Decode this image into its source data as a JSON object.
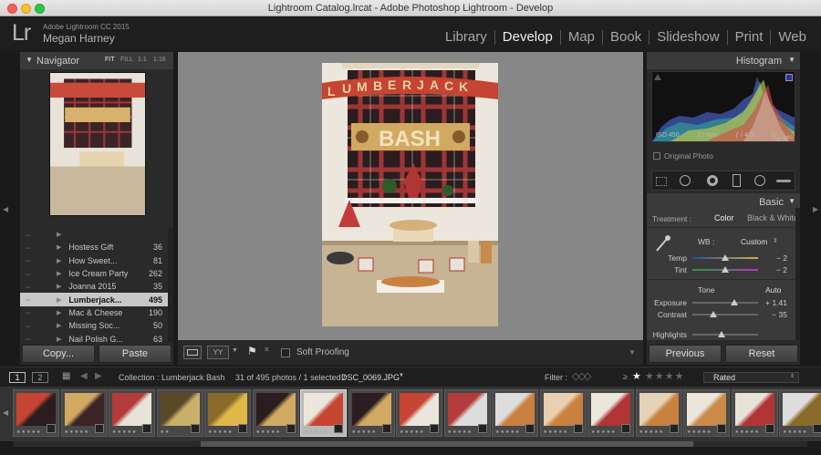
{
  "window": {
    "title": "Lightroom Catalog.lrcat - Adobe Photoshop Lightroom - Develop"
  },
  "identity": {
    "logo": "Lr",
    "product": "Adobe Lightroom CC 2015",
    "user": "Megan Harney"
  },
  "modules": [
    {
      "label": "Library"
    },
    {
      "label": "Develop",
      "active": true
    },
    {
      "label": "Map"
    },
    {
      "label": "Book"
    },
    {
      "label": "Slideshow"
    },
    {
      "label": "Print"
    },
    {
      "label": "Web"
    }
  ],
  "navigator": {
    "title": "Navigator",
    "zoom": [
      "FIT",
      "FILL",
      "1:1",
      "1:16"
    ]
  },
  "collections": [
    {
      "name": "",
      "count": ""
    },
    {
      "name": "Hostess Gift",
      "count": "36"
    },
    {
      "name": "How Sweet...",
      "count": "81"
    },
    {
      "name": "Ice Cream Party",
      "count": "262"
    },
    {
      "name": "Joanna 2015",
      "count": "35"
    },
    {
      "name": "Lumberjack...",
      "count": "495",
      "selected": true
    },
    {
      "name": "Mac & Cheese",
      "count": "190"
    },
    {
      "name": "Missing Soc...",
      "count": "50"
    },
    {
      "name": "Nail Polish G...",
      "count": "63"
    },
    {
      "name": "",
      "count": ""
    }
  ],
  "left_buttons": {
    "copy": "Copy...",
    "paste": "Paste"
  },
  "toolbar": {
    "soft_proofing": "Soft Proofing"
  },
  "histogram": {
    "title": "Histogram",
    "iso": "ISO 450",
    "focal": "27 mm",
    "aperture": "ƒ / 4.0",
    "shutter_num": "1",
    "shutter_den": "15",
    "shutter_unit": "sec",
    "original_photo": "Original Photo"
  },
  "basic": {
    "title": "Basic",
    "treatment_label": "Treatment :",
    "color": "Color",
    "bw": "Black & White",
    "wb_label": "WB :",
    "wb_value": "Custom",
    "temp": {
      "label": "Temp",
      "value": "− 2",
      "pos": 0.5
    },
    "tint": {
      "label": "Tint",
      "value": "− 2",
      "pos": 0.5
    },
    "tone": "Tone",
    "auto": "Auto",
    "exposure": {
      "label": "Exposure",
      "value": "+ 1.41",
      "pos": 0.64
    },
    "contrast": {
      "label": "Contrast",
      "value": "− 35",
      "pos": 0.32
    },
    "highlights": {
      "label": "Highlights",
      "value": "",
      "pos": 0.45
    }
  },
  "right_buttons": {
    "previous": "Previous",
    "reset": "Reset"
  },
  "filmbar": {
    "page1": "1",
    "page2": "2",
    "collection": "Collection : Lumberjack Bash",
    "count_text": "31 of 495 photos / 1 selected /",
    "filename": "DSC_0069.JPG",
    "filter": "Filter :",
    "rated": "Rated"
  },
  "thumbs": [
    {
      "stars": "★★★★★"
    },
    {
      "stars": "★★★★★"
    },
    {
      "stars": "★★★★★"
    },
    {
      "stars": "★★"
    },
    {
      "stars": "★★★★★"
    },
    {
      "stars": "★★★★★"
    },
    {
      "stars": "★★★★★",
      "selected": true
    },
    {
      "stars": "★★★★★"
    },
    {
      "stars": "★★★★★"
    },
    {
      "stars": "★★★★★"
    },
    {
      "stars": "★★★★★"
    },
    {
      "stars": "★★★★★"
    },
    {
      "stars": "★★★★★"
    },
    {
      "stars": "★★★★★"
    },
    {
      "stars": "★★★★★"
    },
    {
      "stars": "★★★★★"
    },
    {
      "stars": "★★★★★"
    }
  ],
  "colors": {
    "accent_red": "#c0392b",
    "plaid_dark": "#2b1d1f",
    "sign_wood": "#d8b26a"
  }
}
